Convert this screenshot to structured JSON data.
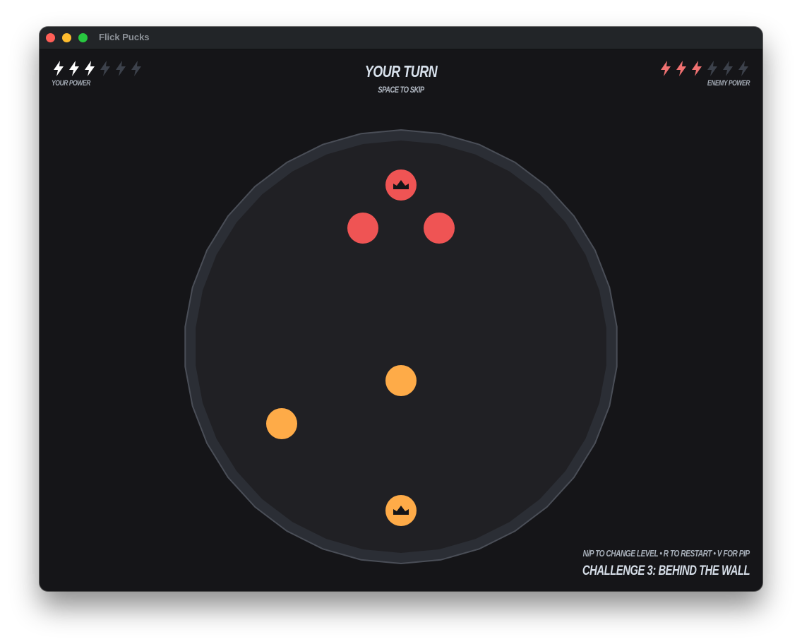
{
  "window": {
    "title": "Flick Pucks"
  },
  "hud": {
    "player_power": {
      "label": "YOUR POWER",
      "filled": 3,
      "total": 6,
      "color": "#ffffff",
      "empty_color": "#3c414b"
    },
    "enemy_power": {
      "label": "ENEMY POWER",
      "filled": 3,
      "total": 6,
      "color": "#f07171",
      "empty_color": "#3c414b"
    },
    "turn_text": "YOUR TURN",
    "turn_hint": "SPACE TO SKIP",
    "help_text": "N/P TO CHANGE LEVEL • R TO RESTART • V FOR PIP",
    "level_title": "CHALLENGE 3: BEHIND THE WALL"
  },
  "colors": {
    "background": "#151518",
    "arena_floor": "#202024",
    "arena_rim": "#2b2e35",
    "arena_rim_edge": "#4a4e57",
    "enemy_puck": "#ef5454",
    "player_puck": "#feab48",
    "king_icon": "#151518"
  },
  "pucks": [
    {
      "team": "enemy",
      "king": true,
      "icon": "crown-icon"
    },
    {
      "team": "enemy",
      "king": false
    },
    {
      "team": "enemy",
      "king": false
    },
    {
      "team": "player",
      "king": false
    },
    {
      "team": "player",
      "king": false
    },
    {
      "team": "player",
      "king": true,
      "icon": "crown-icon"
    }
  ]
}
